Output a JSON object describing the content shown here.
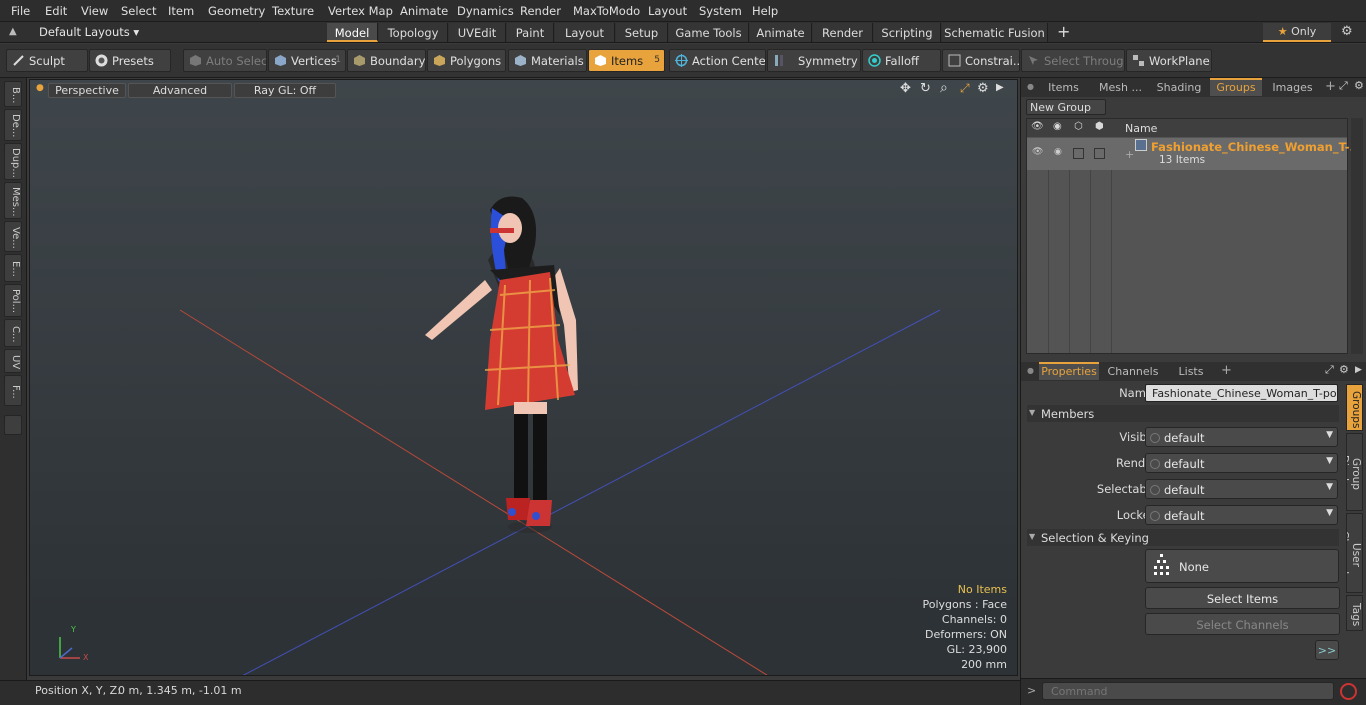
{
  "menu": [
    "File",
    "Edit",
    "View",
    "Select",
    "Item",
    "Geometry",
    "Texture",
    "Vertex Map",
    "Animate",
    "Dynamics",
    "Render",
    "MaxToModo",
    "Layout",
    "System",
    "Help"
  ],
  "layouts_label": "Default Layouts",
  "layout_tabs": [
    "Model",
    "Topology",
    "UVEdit",
    "Paint",
    "Layout",
    "Setup",
    "Game Tools",
    "Animate",
    "Render",
    "Scripting",
    "Schematic Fusion"
  ],
  "only_label": "Only",
  "toolbar": {
    "sculpt": "Sculpt",
    "presets": "Presets",
    "auto_select": "Auto Select",
    "vertices": "Vertices",
    "vertices_count": "1",
    "boundary": "Boundary",
    "polygons": "Polygons",
    "materials": "Materials",
    "items": "Items",
    "items_count": "5",
    "action_center": "Action Center",
    "symmetry": "Symmetry",
    "falloff": "Falloff",
    "constraints": "Constrai...",
    "select_through": "Select Through",
    "workplane": "WorkPlane"
  },
  "left_tabs": [
    "B...",
    "De...",
    "Dup...",
    "Mes...",
    "Ve...",
    "E...",
    "Pol...",
    "C...",
    "UV",
    "F..."
  ],
  "viewport": {
    "perspective": "Perspective",
    "advanced": "Advanced",
    "raygl": "Ray GL: Off",
    "stats": {
      "no_items": "No Items",
      "polygons": "Polygons : Face",
      "channels": "Channels: 0",
      "deformers": "Deformers: ON",
      "gl": "GL: 23,900",
      "size": "200 mm"
    }
  },
  "status": {
    "label": "Position X, Y, Z:",
    "value": "0 m, 1.345 m, -1.01 m"
  },
  "top_panel": {
    "tabs": [
      "Items",
      "Mesh ...",
      "Shading",
      "Groups",
      "Images"
    ],
    "new_group": "New Group",
    "name_header": "Name",
    "group_name": "Fashionate_Chinese_Woman_T-...",
    "group_count": "13 Items"
  },
  "props": {
    "tabs": [
      "Properties",
      "Channels",
      "Lists"
    ],
    "name_label": "Name",
    "name_value": "Fashionate_Chinese_Woman_T-pose (",
    "members": "Members",
    "rows": [
      {
        "label": "Visible",
        "value": "default"
      },
      {
        "label": "Render",
        "value": "default"
      },
      {
        "label": "Selectable",
        "value": "default"
      },
      {
        "label": "Locked",
        "value": "default"
      }
    ],
    "sel_keying": "Selection & Keying",
    "none": "None",
    "select_items": "Select Items",
    "select_channels": "Select Channels",
    "more": ">>",
    "side_tabs": [
      "Groups",
      "Group Display",
      "User Channels",
      "Tags"
    ]
  },
  "command_placeholder": "Command",
  "colors": {
    "accent": "#e8a33c",
    "group_name": "#f0a030"
  }
}
